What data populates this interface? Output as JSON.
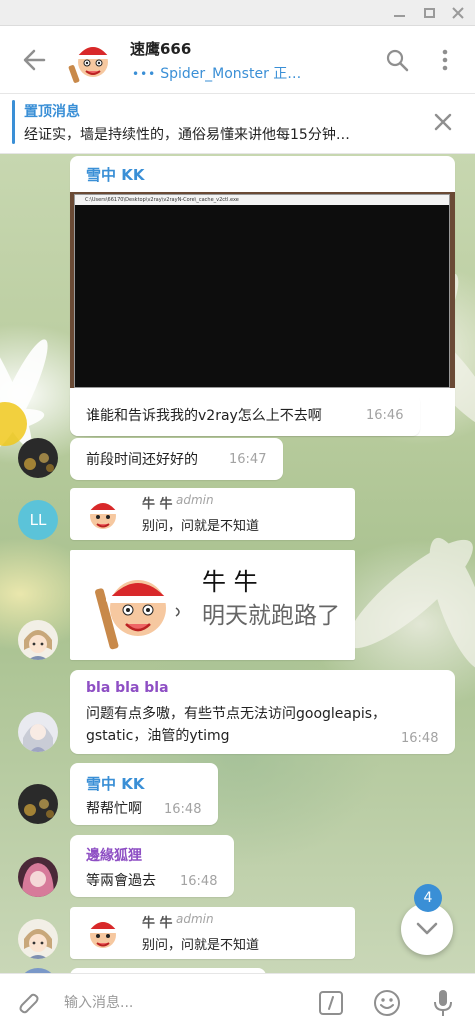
{
  "window": {
    "minimize_icon": "minimize-icon",
    "maximize_icon": "maximize-icon",
    "close_icon": "close-icon"
  },
  "header": {
    "title": "速鹰666",
    "status": "Spider_Monster 正…",
    "status_dots": "•••"
  },
  "pinned": {
    "title": "置顶消息",
    "text": "经证实，墙是持续性的，通俗易懂来讲他每15分钟…"
  },
  "messages": [
    {
      "sender": "雪中 KK",
      "sender_color": "#3a8fd6",
      "screenshot_title": "C:\\Users\\66170\\Desktop\\v2ray\\v2rayN-Core\\_cache_v2ctl.exe",
      "text": "谁能和告诉我我的v2ray怎么上不去啊",
      "time": "16:46"
    },
    {
      "text": "前段时间还好好的",
      "time": "16:47"
    },
    {
      "avatar_initials": "LL",
      "sender": "牛 牛",
      "role": "admin",
      "text": "别问，问就是不知道"
    },
    {
      "sticker_title": "牛 牛",
      "sticker_text": "明天就跑路了"
    },
    {
      "sender": "bla bla bla",
      "sender_color": "#8e4fc4",
      "text_line1": "问题有点多嗷，有些节点无法访问googleapis，",
      "text_line2": "gstatic，油管的ytimg",
      "time": "16:48"
    },
    {
      "sender": "雪中 KK",
      "sender_color": "#3a8fd6",
      "text": "帮帮忙啊",
      "time": "16:48"
    },
    {
      "sender": "邊緣狐狸",
      "sender_color": "#8e4fc4",
      "text": "等兩會過去",
      "time": "16:48"
    },
    {
      "sender": "牛 牛",
      "role": "admin",
      "text": "别问，问就是不知道"
    }
  ],
  "scroll": {
    "unread_count": "4"
  },
  "composer": {
    "placeholder": "输入消息..."
  }
}
